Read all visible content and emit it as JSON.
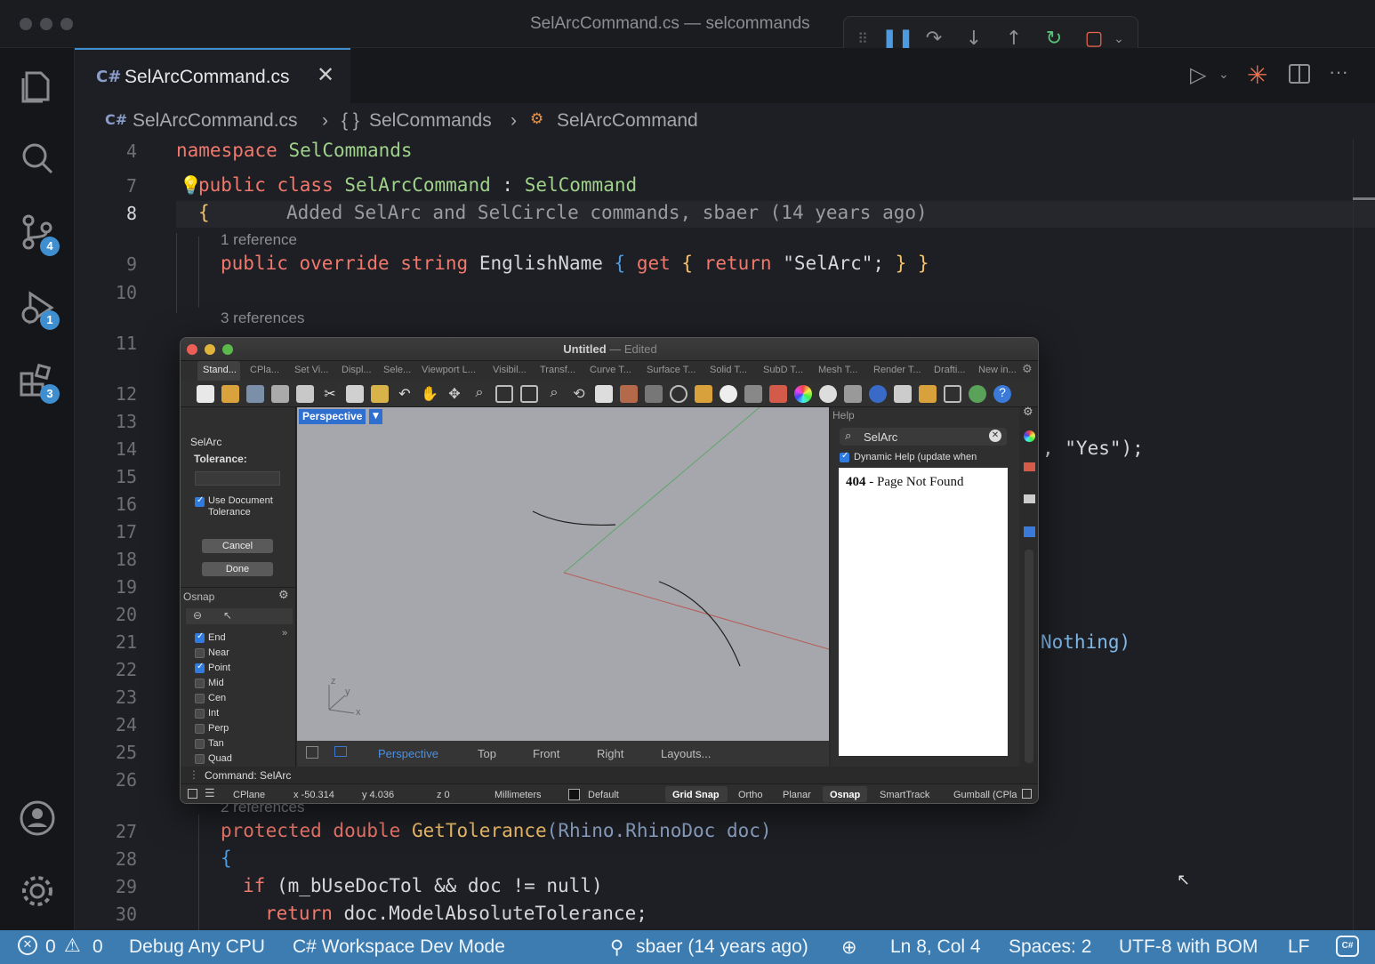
{
  "window": {
    "title": "SelArcCommand.cs — selcommands"
  },
  "activity_bar": {
    "scm_badge": "4",
    "debug_badge": "1",
    "extensions_badge": "3"
  },
  "tab": {
    "label": "SelArcCommand.cs"
  },
  "breadcrumb": {
    "file": "SelArcCommand.cs",
    "namespace": "SelCommands",
    "class": "SelArcCommand",
    "namespace_prefix": "{ }"
  },
  "editor": {
    "line_numbers": [
      "4",
      "7",
      "8",
      "9",
      "10",
      "11",
      "12",
      "13",
      "14",
      "15",
      "16",
      "17",
      "18",
      "19",
      "20",
      "21",
      "22",
      "23",
      "24",
      "25",
      "26",
      "27",
      "28",
      "29",
      "30"
    ],
    "l4": {
      "kw": "namespace",
      "name": "SelCommands"
    },
    "l7": {
      "kw": "public class",
      "name": "SelArcCommand",
      "sep": " : ",
      "base": "SelCommand"
    },
    "l8": {
      "brace": "{",
      "blame": "Added SelArc and SelCircle commands, sbaer (14 years ago)"
    },
    "ref1": "1 reference",
    "l9": {
      "kw": "public override string",
      "name": "EnglishName",
      "open": " { ",
      "get": "get",
      "ob": " { ",
      "ret": "return",
      "str": " \"SelArc\"; ",
      "cb": "} }"
    },
    "ref3": "3 references",
    "l14_tail": ", \"Yes\");",
    "l21_tail": "Nothing)",
    "ref2": "2 references",
    "l27": {
      "kw": "protected double",
      "name": "GetTolerance",
      "args": "(Rhino.RhinoDoc doc)"
    },
    "l28": "{",
    "l29": {
      "kw": "if",
      "body": " (m_bUseDocTol && doc != null)"
    },
    "l30": {
      "kw": "return",
      "body": " doc.ModelAbsoluteTolerance;"
    }
  },
  "rhino": {
    "title": "Untitled",
    "title_suffix": "— Edited",
    "tabs": [
      "Stand...",
      "CPla...",
      "Set Vi...",
      "Displ...",
      "Sele...",
      "Viewport L...",
      "Visibil...",
      "Transf...",
      "Curve T...",
      "Surface T...",
      "Solid T...",
      "SubD T...",
      "Mesh T...",
      "Render T...",
      "Drafti...",
      "New in..."
    ],
    "command_panel": {
      "name": "SelArc",
      "tolerance_label": "Tolerance:",
      "use_doc_tol": "Use Document Tolerance",
      "cancel": "Cancel",
      "done": "Done"
    },
    "osnap": {
      "title": "Osnap",
      "items": [
        {
          "label": "End",
          "checked": true
        },
        {
          "label": "Near",
          "checked": false
        },
        {
          "label": "Point",
          "checked": true
        },
        {
          "label": "Mid",
          "checked": false
        },
        {
          "label": "Cen",
          "checked": false
        },
        {
          "label": "Int",
          "checked": false
        },
        {
          "label": "Perp",
          "checked": false
        },
        {
          "label": "Tan",
          "checked": false
        },
        {
          "label": "Quad",
          "checked": false
        }
      ]
    },
    "viewport": {
      "label": "Perspective",
      "axis_z": "z",
      "axis_y": "y",
      "axis_x": "x"
    },
    "viewport_tabs": [
      "Perspective",
      "Top",
      "Front",
      "Right",
      "Layouts..."
    ],
    "help": {
      "title": "Help",
      "search": "SelArc",
      "dynamic": "Dynamic Help (update when",
      "code": "404",
      "message": " - Page Not Found"
    },
    "command_line": "Command: SelArc",
    "status": {
      "cplane": "CPlane",
      "x": "x -50.314",
      "y": "y 4.036",
      "z": "z 0",
      "units": "Millimeters",
      "layer": "Default",
      "grid_snap": "Grid Snap",
      "ortho": "Ortho",
      "planar": "Planar",
      "osnap": "Osnap",
      "smarttrack": "SmartTrack",
      "gumball": "Gumball (CPla"
    }
  },
  "status_bar": {
    "errors": "0",
    "warnings": "0",
    "config": "Debug Any CPU",
    "workspace": "C# Workspace Dev Mode",
    "blame": "sbaer (14 years ago)",
    "position": "Ln 8, Col 4",
    "spaces": "Spaces: 2",
    "encoding": "UTF-8 with BOM",
    "eol": "LF"
  }
}
